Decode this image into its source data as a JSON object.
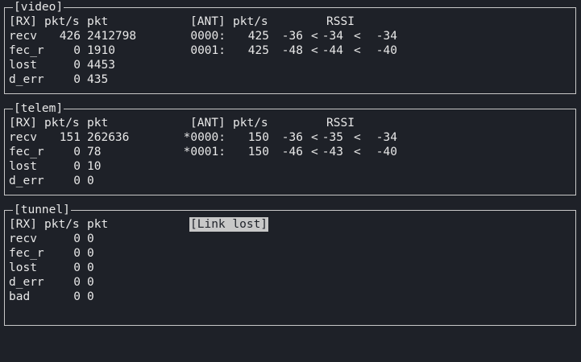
{
  "video": {
    "title": "[video]",
    "header": {
      "rx": "[RX]",
      "pkts": "pkt/s",
      "pkt": "pkt",
      "ant": "[ANT]",
      "ant_pkts": "pkt/s",
      "rssi": "RSSI"
    },
    "rows": [
      {
        "name": "recv",
        "pkts": "426",
        "pkt": "2412798"
      },
      {
        "name": "fec_r",
        "pkts": "0",
        "pkt": "1910"
      },
      {
        "name": "lost",
        "pkts": "0",
        "pkt": "4453"
      },
      {
        "name": "d_err",
        "pkts": "0",
        "pkt": "435"
      }
    ],
    "antennas": [
      {
        "id": "0000:",
        "pkts": "425",
        "min": "-36",
        "avg": "-34",
        "max": "-34"
      },
      {
        "id": "0001:",
        "pkts": "425",
        "min": "-48",
        "avg": "-44",
        "max": "-40"
      }
    ]
  },
  "telem": {
    "title": "[telem]",
    "header": {
      "rx": "[RX]",
      "pkts": "pkt/s",
      "pkt": "pkt",
      "ant": "[ANT]",
      "ant_pkts": "pkt/s",
      "rssi": "RSSI"
    },
    "rows": [
      {
        "name": "recv",
        "pkts": "151",
        "pkt": "262636"
      },
      {
        "name": "fec_r",
        "pkts": "0",
        "pkt": "78"
      },
      {
        "name": "lost",
        "pkts": "0",
        "pkt": "10"
      },
      {
        "name": "d_err",
        "pkts": "0",
        "pkt": "0"
      }
    ],
    "antennas": [
      {
        "id": "*0000:",
        "pkts": "150",
        "min": "-36",
        "avg": "-35",
        "max": "-34"
      },
      {
        "id": "*0001:",
        "pkts": "150",
        "min": "-46",
        "avg": "-43",
        "max": "-40"
      }
    ]
  },
  "tunnel": {
    "title": "[tunnel]",
    "header": {
      "rx": "[RX]",
      "pkts": "pkt/s",
      "pkt": "pkt"
    },
    "status": "[Link lost]",
    "rows": [
      {
        "name": "recv",
        "pkts": "0",
        "pkt": "0"
      },
      {
        "name": "fec_r",
        "pkts": "0",
        "pkt": "0"
      },
      {
        "name": "lost",
        "pkts": "0",
        "pkt": "0"
      },
      {
        "name": "d_err",
        "pkts": "0",
        "pkt": "0"
      },
      {
        "name": "bad",
        "pkts": "0",
        "pkt": "0"
      }
    ]
  },
  "symbols": {
    "lt": "<"
  }
}
